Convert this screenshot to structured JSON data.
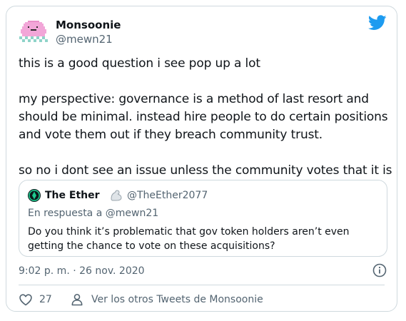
{
  "author": {
    "name": "Monsoonie",
    "handle": "@mewn21"
  },
  "tweet": {
    "text": "this is a good question i see pop up a lot\n\nmy perspective: governance is a method of last resort and should be minimal. instead hire people to do certain positions and vote them out if they breach community trust.\n\nso no i dont see an issue unless the community votes that it is"
  },
  "quote": {
    "name": "The Ether",
    "handle": "@TheEther2077",
    "reply_to": "En respuesta a @mewn21",
    "text": "Do you think it’s problematic that gov token holders aren’t even getting the chance to vote on these acquisitions?"
  },
  "meta": {
    "timestamp": "9:02 p. m. · 26 nov. 2020"
  },
  "actions": {
    "like_count": "27",
    "more_tweets": "Ver los otros Tweets de Monsoonie"
  },
  "colors": {
    "accent": "#1d9bf0",
    "muted": "#536471",
    "border": "#cfd9de",
    "avatar_pink": "#f2a6d8"
  },
  "icons": {
    "header": "twitter-bird-icon",
    "info": "info-icon",
    "like": "heart-icon",
    "profile": "person-icon",
    "quote_flex": "flexed-biceps-icon"
  }
}
